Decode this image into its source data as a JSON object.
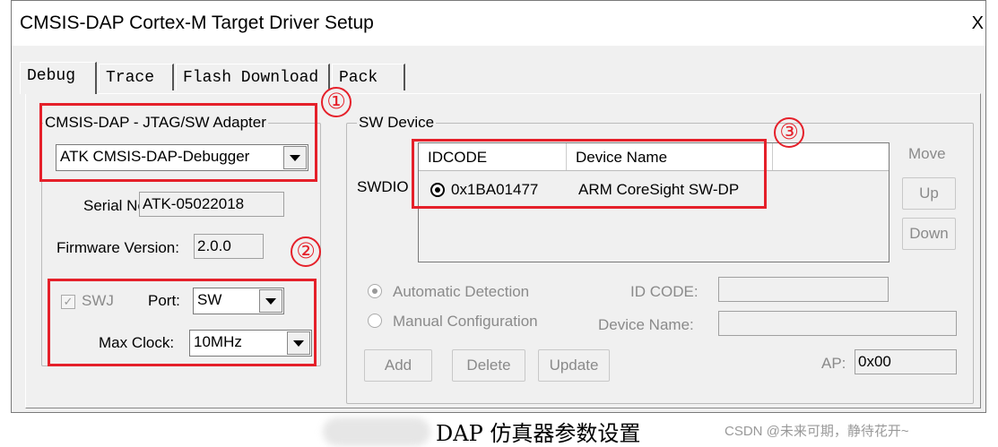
{
  "window": {
    "title": "CMSIS-DAP Cortex-M Target Driver Setup",
    "close_glyph": "X"
  },
  "tabs": [
    {
      "label": "Debug",
      "active": true
    },
    {
      "label": "Trace",
      "active": false
    },
    {
      "label": "Flash Download",
      "active": false
    },
    {
      "label": "Pack",
      "active": false
    }
  ],
  "adapter": {
    "group_label": "CMSIS-DAP - JTAG/SW Adapter",
    "selected": "ATK CMSIS-DAP-Debugger",
    "serial_label": "Serial No:",
    "serial_value": "ATK-05022018",
    "firmware_label": "Firmware Version:",
    "firmware_value": "2.0.0",
    "swj_label": "SWJ",
    "swj_checked": true,
    "port_label": "Port:",
    "port_value": "SW",
    "maxclock_label": "Max Clock:",
    "maxclock_value": "10MHz"
  },
  "sw_device": {
    "group_label": "SW Device",
    "swdio_label": "SWDIO",
    "columns": [
      "IDCODE",
      "Device Name"
    ],
    "rows": [
      {
        "idcode": "0x1BA01477",
        "device_name": "ARM CoreSight SW-DP"
      }
    ],
    "move_label": "Move",
    "up_label": "Up",
    "down_label": "Down",
    "auto_detect_label": "Automatic Detection",
    "manual_config_label": "Manual Configuration",
    "id_code_label": "ID CODE:",
    "device_name_label": "Device Name:",
    "add_label": "Add",
    "delete_label": "Delete",
    "update_label": "Update",
    "ap_label": "AP:",
    "ap_value": "0x00"
  },
  "annotations": {
    "one": "①",
    "two": "②",
    "three": "③",
    "color": "#e5202a"
  },
  "caption": "DAP 仿真器参数设置",
  "watermark": "CSDN @未来可期，静待花开~"
}
